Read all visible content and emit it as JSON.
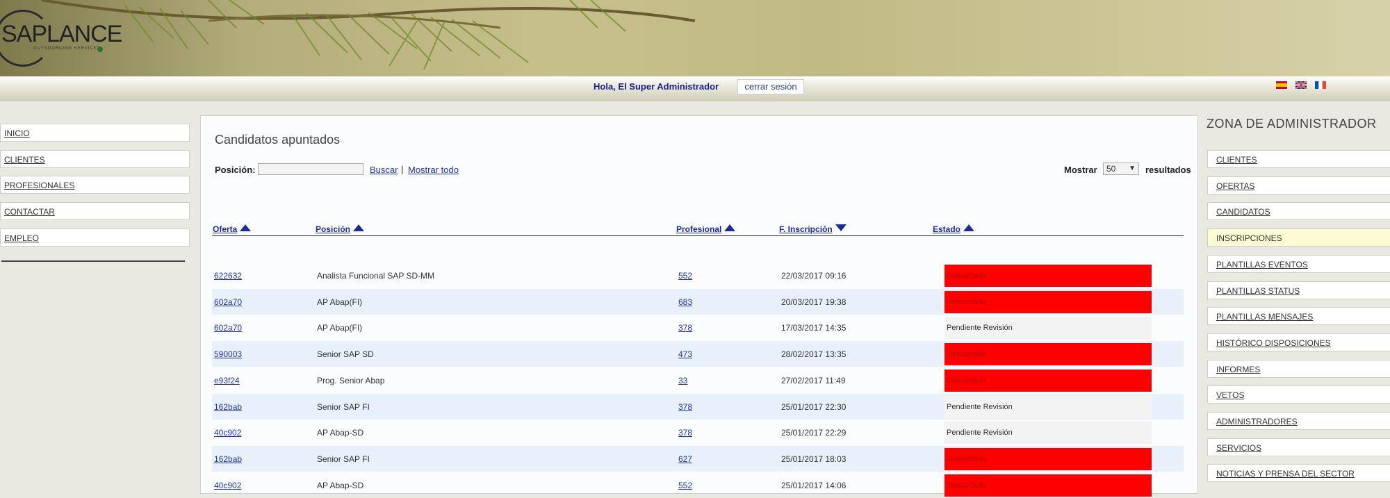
{
  "header": {
    "logo_text": "SAPLANCE",
    "logo_subtitle": "OUTSOURCING SERVICES"
  },
  "topbar": {
    "greeting": "Hola, El Super Administrador",
    "logout_label": "cerrar sesión",
    "flags": [
      "spain-flag-icon",
      "uk-flag-icon",
      "france-flag-icon"
    ]
  },
  "left_nav": [
    "INICIO",
    "CLIENTES",
    "PROFESIONALES",
    "CONTACTAR",
    "EMPLEO"
  ],
  "main": {
    "title": "Candidatos apuntados",
    "search": {
      "label": "Posición:",
      "value": "",
      "search_label": "Buscar",
      "separator": "|",
      "show_all_label": "Mostrar todo"
    },
    "pagination": {
      "show_label": "Mostrar",
      "per_page": "50",
      "results_label": "resultados"
    },
    "columns": [
      {
        "label": "Oferta",
        "sort": "asc"
      },
      {
        "label": "Posición",
        "sort": "asc"
      },
      {
        "label": "Profesional",
        "sort": "asc"
      },
      {
        "label": "F. Inscripción",
        "sort": "desc"
      },
      {
        "label": "Estado",
        "sort": "asc"
      }
    ],
    "rows": [
      {
        "oferta": "622632",
        "posicion": "Analista Funcional SAP SD-MM",
        "profesional": "552",
        "fecha": "22/03/2017 09:16",
        "estado": "Descartado",
        "estado_type": "red"
      },
      {
        "oferta": "602a70",
        "posicion": "AP Abap(FI)",
        "profesional": "683",
        "fecha": "20/03/2017 19:38",
        "estado": "Descartado",
        "estado_type": "red"
      },
      {
        "oferta": "602a70",
        "posicion": "AP Abap(FI)",
        "profesional": "378",
        "fecha": "17/03/2017 14:35",
        "estado": "Pendiente Revisión",
        "estado_type": "grey"
      },
      {
        "oferta": "590003",
        "posicion": "Senior SAP SD",
        "profesional": "473",
        "fecha": "28/02/2017 13:35",
        "estado": "Descartado",
        "estado_type": "red"
      },
      {
        "oferta": "e93f24",
        "posicion": "Prog. Senior Abap",
        "profesional": "33",
        "fecha": "27/02/2017 11:49",
        "estado": "Descartado",
        "estado_type": "red"
      },
      {
        "oferta": "162bab",
        "posicion": "Senior SAP FI",
        "profesional": "378",
        "fecha": "25/01/2017 22:30",
        "estado": "Pendiente Revisión",
        "estado_type": "grey"
      },
      {
        "oferta": "40c902",
        "posicion": "AP Abap-SD",
        "profesional": "378",
        "fecha": "25/01/2017 22:29",
        "estado": "Pendiente Revisión",
        "estado_type": "grey"
      },
      {
        "oferta": "162bab",
        "posicion": "Senior SAP FI",
        "profesional": "627",
        "fecha": "25/01/2017 18:03",
        "estado": "Descartado",
        "estado_type": "red"
      },
      {
        "oferta": "40c902",
        "posicion": "AP Abap-SD",
        "profesional": "552",
        "fecha": "25/01/2017 14:06",
        "estado": "Descartado",
        "estado_type": "red"
      }
    ]
  },
  "admin": {
    "title": "ZONA DE ADMINISTRADOR",
    "active": "INSCRIPCIONES",
    "items": [
      "CLIENTES",
      "OFERTAS",
      "CANDIDATOS",
      "INSCRIPCIONES",
      "PLANTILLAS EVENTOS",
      "PLANTILLAS STATUS",
      "PLANTILLAS MENSAJES",
      "HISTÓRICO DISPOSICIONES",
      "INFORMES",
      "VETOS",
      "ADMINISTRADORES",
      "SERVICIOS",
      "NOTICIAS Y PRENSA DEL SECTOR"
    ]
  },
  "colors": {
    "link": "#2233aa",
    "header_link": "#1c2a9c",
    "status_red": "#ff0000",
    "status_grey": "#f3f3f3",
    "row_alt": "#e8f0fb",
    "active_menu": "#fdfbd3"
  }
}
